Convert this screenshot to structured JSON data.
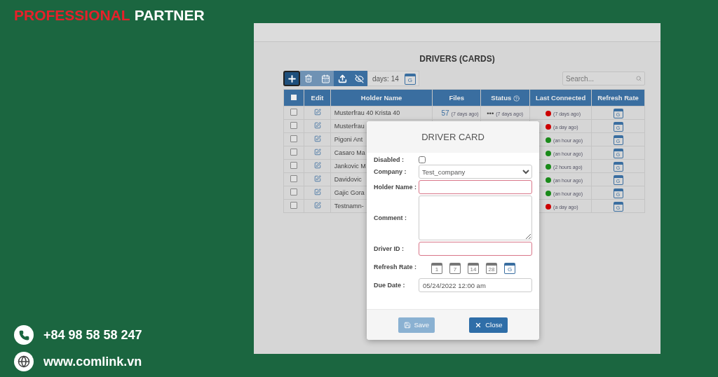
{
  "brand": {
    "accent": "PROFESSIONAL",
    "rest": "PARTNER"
  },
  "contacts": [
    {
      "kind": "phone",
      "text": "+84 98 58 58 247"
    },
    {
      "kind": "web",
      "text": "www.comlink.vn"
    }
  ],
  "page": {
    "title": "DRIVERS (CARDS)",
    "toolbar": {
      "buttons": [
        {
          "kind": "add",
          "disabled": false
        },
        {
          "kind": "delete",
          "disabled": true
        },
        {
          "kind": "calendar",
          "disabled": true
        },
        {
          "kind": "upload",
          "disabled": false
        },
        {
          "kind": "hide",
          "disabled": false
        }
      ],
      "days": "days: 14",
      "days_icon": "G",
      "search_placeholder": "Search..."
    },
    "table": {
      "select_all_checked": false,
      "columns": [
        "Edit",
        "Holder Name",
        "Files",
        "Status",
        "Last Connected",
        "Refresh Rate"
      ],
      "rows": [
        {
          "checked": false,
          "holder": "Musterfrau 40 Krista 40",
          "files": "57",
          "files_time": "(7 days ago)",
          "status": "•••",
          "status_time": "(7 days ago)",
          "color": "#cc0000",
          "last": "(7 days ago)",
          "rate": "G"
        },
        {
          "checked": false,
          "holder": "Musterfrau",
          "color": "#cc0000",
          "last": "(a day ago)",
          "rate": "G"
        },
        {
          "checked": false,
          "holder": "Pigoni Ant",
          "color": "#1a8a1a",
          "last": "(an hour ago)",
          "rate": "G"
        },
        {
          "checked": false,
          "holder": "Casaro Ma",
          "color": "#1a8a1a",
          "last": "(an hour ago)",
          "rate": "G"
        },
        {
          "checked": false,
          "holder": "Jankovic M",
          "color": "#1a8a1a",
          "last": "(2 hours ago)",
          "rate": "G"
        },
        {
          "checked": false,
          "holder": "Davidovic",
          "color": "#1a8a1a",
          "last": "(an hour ago)",
          "rate": "G"
        },
        {
          "checked": false,
          "holder": "Gajic Gora",
          "color": "#1a8a1a",
          "last": "(an hour ago)",
          "rate": "G"
        },
        {
          "checked": false,
          "holder": "Testnamn-",
          "color": "#cc0000",
          "last": "(a day ago)",
          "rate": "G"
        }
      ]
    }
  },
  "dialog": {
    "title": "DRIVER CARD",
    "fields": [
      {
        "kind": "checkbox",
        "label": "Disabled :",
        "checked": false
      },
      {
        "kind": "select",
        "label": "Company :",
        "value": "Test_company"
      },
      {
        "kind": "text",
        "label": "Holder Name :",
        "invalid": true
      },
      {
        "kind": "textarea",
        "label": "Comment :"
      },
      {
        "kind": "text",
        "label": "Driver ID :",
        "invalid": true
      },
      {
        "kind": "rate",
        "label": "Refresh Rate :",
        "options": [
          {
            "label": "1",
            "selected": false
          },
          {
            "label": "7",
            "selected": false
          },
          {
            "label": "14",
            "selected": false
          },
          {
            "label": "28",
            "selected": false
          },
          {
            "label": "G",
            "selected": true
          }
        ]
      },
      {
        "kind": "text",
        "label": "Due Date :",
        "value": "05/24/2022 12:00 am",
        "invalid": false
      }
    ],
    "buttons": [
      {
        "kind": "save",
        "label": "Save",
        "disabled": true
      },
      {
        "kind": "close",
        "label": "Close",
        "disabled": false
      }
    ]
  }
}
